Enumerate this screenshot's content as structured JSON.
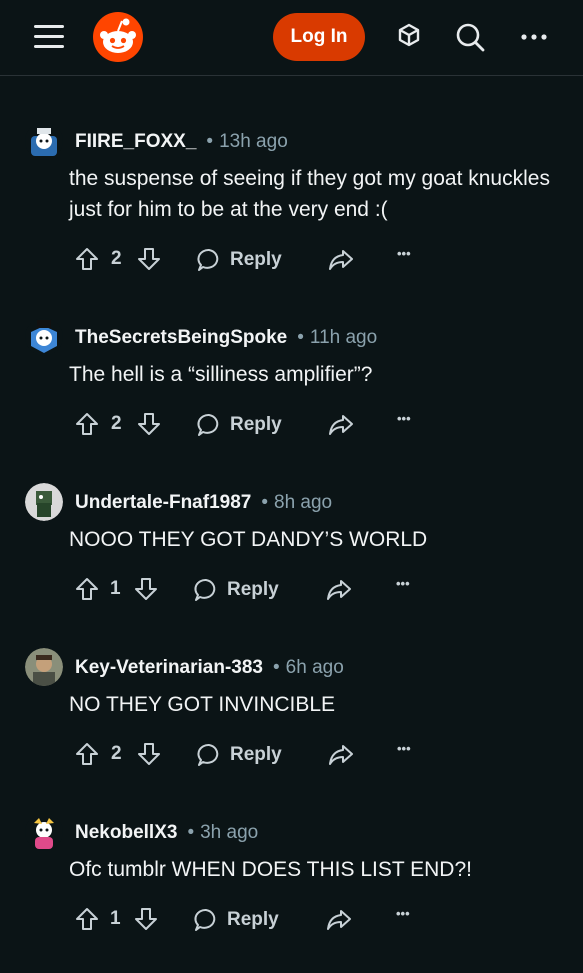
{
  "header": {
    "login_label": "Log In"
  },
  "reply_label": "Reply",
  "more_label": "•••",
  "colors": {
    "accent": "#ff4500",
    "login_bg": "#d93a00",
    "background": "#0b1416",
    "muted": "#8ba2ad"
  },
  "comments": [
    {
      "author": "FIIRE_FOXX_",
      "time": "13h ago",
      "text": "the suspense of seeing if they got my goat knuckles just for him to be at the very end :(",
      "votes": "2"
    },
    {
      "author": "TheSecretsBeingSpoke",
      "time": "11h ago",
      "text": "The hell is a “silliness amplifier”?",
      "votes": "2"
    },
    {
      "author": "Undertale-Fnaf1987",
      "time": "8h ago",
      "text": "NOOO THEY GOT DANDY’S WORLD",
      "votes": "1"
    },
    {
      "author": "Key-Veterinarian-383",
      "time": "6h ago",
      "text": "NO THEY GOT INVINCIBLE",
      "votes": "2"
    },
    {
      "author": "NekobellX3",
      "time": "3h ago",
      "text": "Ofc tumblr WHEN DOES THIS LIST END?!",
      "votes": "1"
    }
  ]
}
